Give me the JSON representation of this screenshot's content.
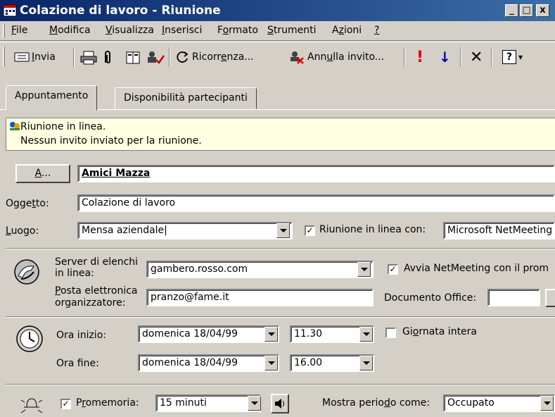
{
  "window": {
    "title": "Colazione di lavoro - Riunione",
    "controls": {
      "minimize": "_",
      "maximize": "□",
      "close": "x"
    }
  },
  "menu": [
    {
      "pre": "",
      "u": "F",
      "post": "ile"
    },
    {
      "pre": "",
      "u": "M",
      "post": "odifica"
    },
    {
      "pre": "",
      "u": "V",
      "post": "isualizza"
    },
    {
      "pre": "",
      "u": "I",
      "post": "nserisci"
    },
    {
      "pre": "F",
      "u": "o",
      "post": "rmato"
    },
    {
      "pre": "",
      "u": "S",
      "post": "trumenti"
    },
    {
      "pre": "A",
      "u": "z",
      "post": "ioni"
    },
    {
      "pre": "",
      "u": "?",
      "post": ""
    }
  ],
  "toolbar": {
    "send_pre": "",
    "send_u": "I",
    "send_post": "nvia",
    "recurrence_pre": "Ricorr",
    "recurrence_u": "e",
    "recurrence_post": "nza...",
    "cancel_invite_pre": "Ann",
    "cancel_invite_u": "u",
    "cancel_invite_post": "lla invito...",
    "importance_high": "!",
    "importance_low": "↓",
    "delete": "✕",
    "help": "?"
  },
  "tabs": {
    "appointment": "Appuntamento",
    "availability": "Disponibilità partecipanti"
  },
  "banner": {
    "line1": "Riunione in linea.",
    "line2": "Nessun invito inviato per la riunione."
  },
  "form": {
    "to_button_u": "A",
    "to_button_post": "...",
    "to_value": "Amici Mazza",
    "subject_label_pre": "Ogge",
    "subject_label_u": "t",
    "subject_label_post": "to:",
    "subject_value": "Colazione di lavoro",
    "location_label_pre": "",
    "location_label_u": "L",
    "location_label_post": "uogo:",
    "location_value": "Mensa aziendale",
    "online_meeting_check": "✓",
    "online_meeting_label": "Riunione in linea con:",
    "online_meeting_value": "Microsoft NetMeeting",
    "directory_label_1": "Server di elenchi",
    "directory_label_2": "in linea:",
    "directory_value": "gambero.rosso.com",
    "autostart_check": "✓",
    "autostart_label": "Avvia NetMeeting con il prom",
    "email_label_1_u": "P",
    "email_label_1_post": "osta elettronica",
    "email_label_2": "organizzatore:",
    "email_value": "pranzo@fame.it",
    "office_doc_label": "Documento Office:",
    "start_label": "Ora inizio:",
    "start_date": "domenica 18/04/99",
    "start_time": "11.30",
    "allday_label_pre": "Gi",
    "allday_label_u": "o",
    "allday_label_post": "rnata intera",
    "end_label": "Ora fine:",
    "end_date": "domenica 18/04/99",
    "end_time": "16.00",
    "reminder_check": "✓",
    "reminder_label_pre": "P",
    "reminder_label_u": "r",
    "reminder_label_post": "omemoria:",
    "reminder_value": "15 minuti",
    "show_as_label_pre": "Mostra perio",
    "show_as_label_u": "d",
    "show_as_label_post": "o come:",
    "show_as_value": "Occupato"
  }
}
